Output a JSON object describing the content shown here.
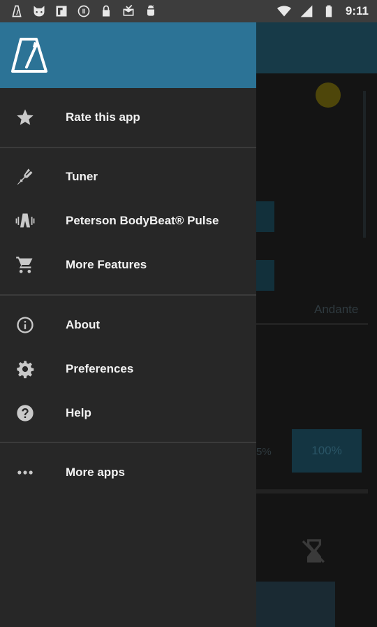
{
  "status_bar": {
    "time": "9:11",
    "left_icons": [
      "metronome-app-icon",
      "cat-face-icon",
      "flipboard-icon",
      "settings-circle-icon",
      "lock-icon",
      "mail-check-icon",
      "android-icon"
    ],
    "right_icons": [
      "wifi-icon",
      "signal-icon",
      "battery-icon"
    ]
  },
  "background": {
    "tempo_label": "Andante",
    "percent_left": "5%",
    "percent_right": "100%"
  },
  "drawer": {
    "header_color": "#2c7396",
    "items": [
      {
        "id": "rate",
        "label": "Rate this app",
        "icon": "star-icon"
      },
      {
        "id": "tuner",
        "label": "Tuner",
        "icon": "tuning-fork-icon"
      },
      {
        "id": "bodybeat",
        "label": "Peterson BodyBeat® Pulse",
        "icon": "vibration-icon"
      },
      {
        "id": "features",
        "label": "More Features",
        "icon": "cart-icon"
      },
      {
        "id": "about",
        "label": "About",
        "icon": "info-icon"
      },
      {
        "id": "prefs",
        "label": "Preferences",
        "icon": "gear-icon"
      },
      {
        "id": "help",
        "label": "Help",
        "icon": "help-icon"
      },
      {
        "id": "more_apps",
        "label": "More apps",
        "icon": "more-dots-icon"
      }
    ]
  }
}
